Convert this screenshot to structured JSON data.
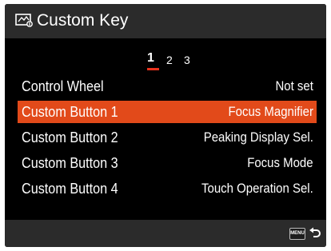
{
  "header": {
    "title": "Custom Key",
    "icon": "custom-key-icon"
  },
  "pagination": {
    "pages": [
      "1",
      "2",
      "3"
    ],
    "active_page": "1",
    "accent_color": "#e8321c"
  },
  "rows": [
    {
      "label": "Control Wheel",
      "value": "Not set",
      "selected": false
    },
    {
      "label": "Custom Button 1",
      "value": "Focus Magnifier",
      "selected": true
    },
    {
      "label": "Custom Button 2",
      "value": "Peaking Display Sel.",
      "selected": false
    },
    {
      "label": "Custom Button 3",
      "value": "Focus Mode",
      "selected": false
    },
    {
      "label": "Custom Button 4",
      "value": "Touch Operation Sel.",
      "selected": false
    }
  ],
  "footer": {
    "menu_button_label": "MENU",
    "back_icon": "return-arrow-icon"
  },
  "colors": {
    "selection": "#e24a1a",
    "bar_background": "#2b2b2b",
    "background": "#000000",
    "text": "#ffffff"
  }
}
